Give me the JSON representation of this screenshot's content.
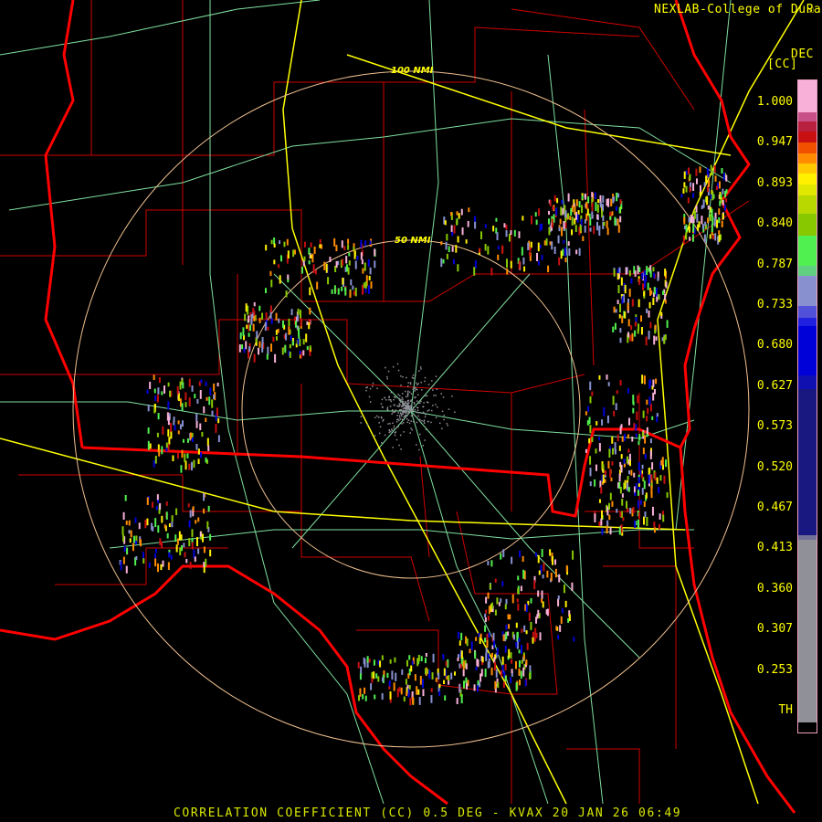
{
  "header": {
    "credit": "NEXLAB-College of DuPage",
    "units_top": "DEC",
    "units": "[CC]"
  },
  "caption": "CORRELATION COEFFICIENT (CC) 0.5 DEG - KVAX 20 JAN 26 06:49",
  "range_rings": [
    {
      "label": "100 NMI"
    },
    {
      "label": "50 NMI"
    }
  ],
  "legend": {
    "ticks": [
      "1.000",
      "0.947",
      "0.893",
      "0.840",
      "0.787",
      "0.733",
      "0.680",
      "0.627",
      "0.573",
      "0.520",
      "0.467",
      "0.413",
      "0.360",
      "0.307",
      "0.253",
      "TH"
    ],
    "colors": [
      "#f8b0d8",
      "#c85088",
      "#b82040",
      "#c81010",
      "#f05000",
      "#ff8c00",
      "#ffc800",
      "#fff000",
      "#e0e800",
      "#b8d800",
      "#88c800",
      "#50f050",
      "#60d080",
      "#8890d0",
      "#5050d8",
      "#2020e0",
      "#0000d8",
      "#1010b0",
      "#181880",
      "#707098",
      "#909098"
    ]
  },
  "colors": {
    "state_border": "#ff0000",
    "county": "#d00000",
    "highway": "#ffff00",
    "road": "#80e0a0",
    "ring": "#f0c090"
  }
}
